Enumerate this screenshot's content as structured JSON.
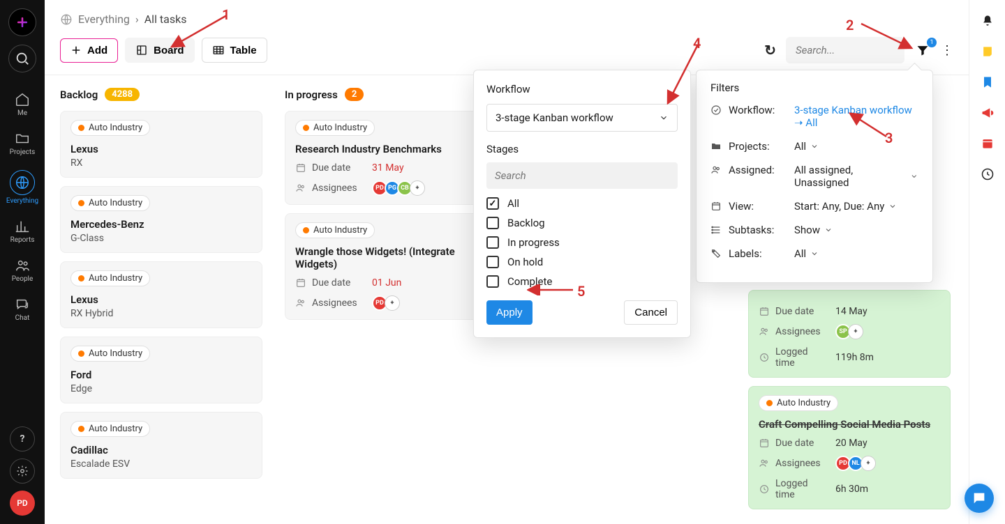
{
  "sidebar": {
    "nav": [
      {
        "label": "Me"
      },
      {
        "label": "Projects"
      },
      {
        "label": "Everything",
        "active": true
      },
      {
        "label": "Reports"
      },
      {
        "label": "People"
      },
      {
        "label": "Chat"
      }
    ],
    "avatar": "PD"
  },
  "breadcrumb": {
    "root": "Everything",
    "sep": "›",
    "leaf": "All tasks"
  },
  "toolbar": {
    "add": "Add",
    "board": "Board",
    "table": "Table",
    "search_placeholder": "Search...",
    "filter_badge": "1"
  },
  "columns": {
    "backlog": {
      "title": "Backlog",
      "count": "4288"
    },
    "inprogress": {
      "title": "In progress",
      "count": "2"
    }
  },
  "project_tag": "Auto Industry",
  "backlog_cards": [
    {
      "title": "Lexus",
      "sub": "RX"
    },
    {
      "title": "Mercedes-Benz",
      "sub": "G-Class"
    },
    {
      "title": "Lexus",
      "sub": "RX Hybrid"
    },
    {
      "title": "Ford",
      "sub": "Edge"
    },
    {
      "title": "Cadillac",
      "sub": "Escalade ESV"
    }
  ],
  "inprogress_cards": [
    {
      "title": "Research Industry Benchmarks",
      "due_label": "Due date",
      "due": "31 May",
      "assignees_label": "Assignees",
      "avatars": [
        "PD",
        "PG",
        "CB"
      ]
    },
    {
      "title": "Wrangle those Widgets! (Integrate Widgets)",
      "due_label": "Due date",
      "due": "01 Jun",
      "assignees_label": "Assignees",
      "avatars": [
        "PD"
      ]
    }
  ],
  "completed_cards": [
    {
      "title": "",
      "due_label": "Due date",
      "due": "14 May",
      "assignees_label": "Assignees",
      "avatars": [
        "SP"
      ],
      "logged_label": "Logged time",
      "logged": "119h 8m"
    },
    {
      "title": "Craft Compelling Social Media Posts",
      "due_label": "Due date",
      "due": "20 May",
      "assignees_label": "Assignees",
      "avatars": [
        "PD",
        "NL"
      ],
      "logged_label": "Logged time",
      "logged": "6h 30m"
    }
  ],
  "workflow_popover": {
    "section": "Workflow",
    "selected": "3-stage Kanban workflow",
    "stages_label": "Stages",
    "search_placeholder": "Search",
    "stages": [
      {
        "label": "All",
        "checked": true
      },
      {
        "label": "Backlog",
        "checked": false
      },
      {
        "label": "In progress",
        "checked": false
      },
      {
        "label": "On hold",
        "checked": false
      },
      {
        "label": "Complete",
        "checked": false
      }
    ],
    "apply": "Apply",
    "cancel": "Cancel"
  },
  "filters_popover": {
    "title": "Filters",
    "rows": [
      {
        "label": "Workflow:",
        "value": "3-stage Kanban workflow ➝ All",
        "link": true
      },
      {
        "label": "Projects:",
        "value": "All"
      },
      {
        "label": "Assigned:",
        "value": "All assigned, Unassigned"
      },
      {
        "label": "View:",
        "value": "Start: Any, Due: Any"
      },
      {
        "label": "Subtasks:",
        "value": "Show"
      },
      {
        "label": "Labels:",
        "value": "All"
      }
    ]
  },
  "annotations": {
    "1": "1",
    "2": "2",
    "3": "3",
    "4": "4",
    "5": "5"
  }
}
